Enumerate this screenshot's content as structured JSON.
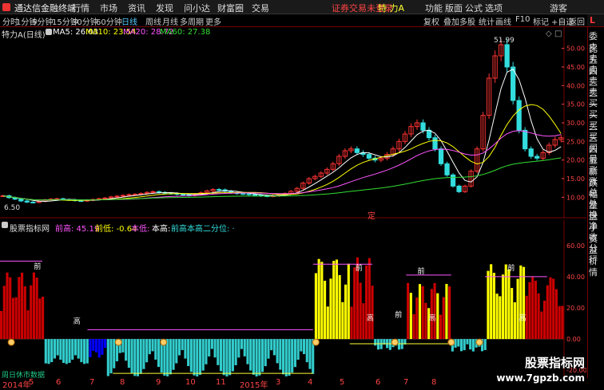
{
  "app_title": "通达信金融终端",
  "top_menu": [
    "行情",
    "市场",
    "资讯",
    "发现",
    "问小达",
    "财富圈",
    "交易"
  ],
  "top_right": {
    "alert": "证券交易未登录",
    "stock": "特 力A",
    "func": "功能",
    "layout": "版面",
    "formula": "公式",
    "options": "选项",
    "guest": "游客"
  },
  "periods": [
    "分时",
    "1分钟",
    "5分钟",
    "15分钟",
    "30分钟",
    "60分钟",
    "日线",
    "周线",
    "月线",
    "多周期",
    "更多"
  ],
  "active_period": "日线",
  "tools": [
    "复权",
    "叠加",
    "多股",
    "统计",
    "画线",
    "F10",
    "标记",
    "+自选",
    "返回"
  ],
  "main_title": "特力A(日线)",
  "ma_legend": [
    {
      "label": "MA5: 26.03",
      "color": "#ffffff"
    },
    {
      "label": "MA10: 23.54",
      "color": "#ffff00"
    },
    {
      "label": "MA20: 28.72",
      "color": "#ff55ff"
    },
    {
      "label": "MA60: 27.38",
      "color": "#33dd33"
    }
  ],
  "high_label": "51.99",
  "low_label": "6.50",
  "main_marker": "定",
  "price_axis": [
    "50.00",
    "45.00",
    "40.00",
    "35.00",
    "30.00",
    "25.00",
    "20.00",
    "15.00",
    "10.00"
  ],
  "sub_title": "股票指标网",
  "sub_legend": [
    {
      "label": "前高: 45.19",
      "color": "#ff55ff"
    },
    {
      "label": "前低: -0.64",
      "color": "#ffff00"
    },
    {
      "label": "本低: ·",
      "color": "#ff55ff"
    },
    {
      "label": "本高: ·",
      "color": "#ffffff"
    },
    {
      "label": "前高本高二分位: ·",
      "color": "#33dddd"
    }
  ],
  "sub_axis": [
    "60.00",
    "40.00",
    "20.00",
    "0.00",
    "-20.00"
  ],
  "sub_markers": {
    "qian": "前",
    "gao": "高"
  },
  "sub_note": "周日休市数据",
  "time_axis": [
    "2014年",
    "5",
    "6",
    "7",
    "8",
    "9",
    "10",
    "11",
    "2015年",
    "3",
    "4",
    "5",
    "6",
    "7",
    "8"
  ],
  "right_panel": [
    "委比",
    "卖五",
    "卖四",
    "卖三",
    "卖二",
    "卖一",
    "买一",
    "买二",
    "买三",
    "买四",
    "买五",
    "最新",
    "涨跌",
    "涨幅",
    "总量",
    "外盘",
    "换手",
    "净资",
    "收益",
    "分析",
    "行情"
  ],
  "watermark": {
    "title": "股票指标网",
    "url": "www.7gpzb.com"
  },
  "colors": {
    "up": "#ff3333",
    "down": "#33dddd",
    "grid": "#700000",
    "axis_text": "#ff4444",
    "bar_yellow": "#ffff00",
    "bar_red": "#cc0000",
    "bar_blue": "#0000ff",
    "bar_cyan": "#33cccc"
  },
  "chart_data": {
    "type": "line",
    "price_close": [
      10.4,
      9.9,
      9.5,
      9.0,
      8.7,
      8.6,
      8.9,
      9.3,
      9.5,
      9.6,
      9.4,
      9.3,
      9.1,
      9.0,
      9.2,
      9.4,
      9.6,
      9.8,
      10.1,
      10.3,
      10.5,
      10.7,
      10.8,
      11.0,
      11.3,
      11.5,
      11.3,
      11.1,
      11.0,
      10.8,
      10.6,
      10.5,
      10.8,
      11.2,
      11.7,
      12.1,
      12.0,
      11.6,
      11.2,
      11.0,
      10.9,
      10.7,
      10.6,
      10.4,
      10.3,
      10.4,
      10.6,
      11.0,
      11.6,
      12.4,
      13.8,
      15.0,
      15.6,
      16.5,
      17.5,
      19.0,
      21.0,
      22.5,
      23.0,
      22.0,
      21.5,
      20.5,
      20.0,
      20.5,
      21.5,
      23.0,
      25.0,
      27.0,
      29.0,
      30.0,
      28.0,
      26.0,
      23.0,
      19.0,
      16.0,
      13.0,
      11.5,
      13.0,
      17.0,
      23.0,
      32.0,
      42.0,
      48.0,
      51.0,
      45.0,
      36.0,
      28.0,
      23.0,
      21.0,
      20.5,
      22.0,
      24.0,
      25.5,
      26.0
    ],
    "ylim": [
      6,
      54
    ]
  }
}
